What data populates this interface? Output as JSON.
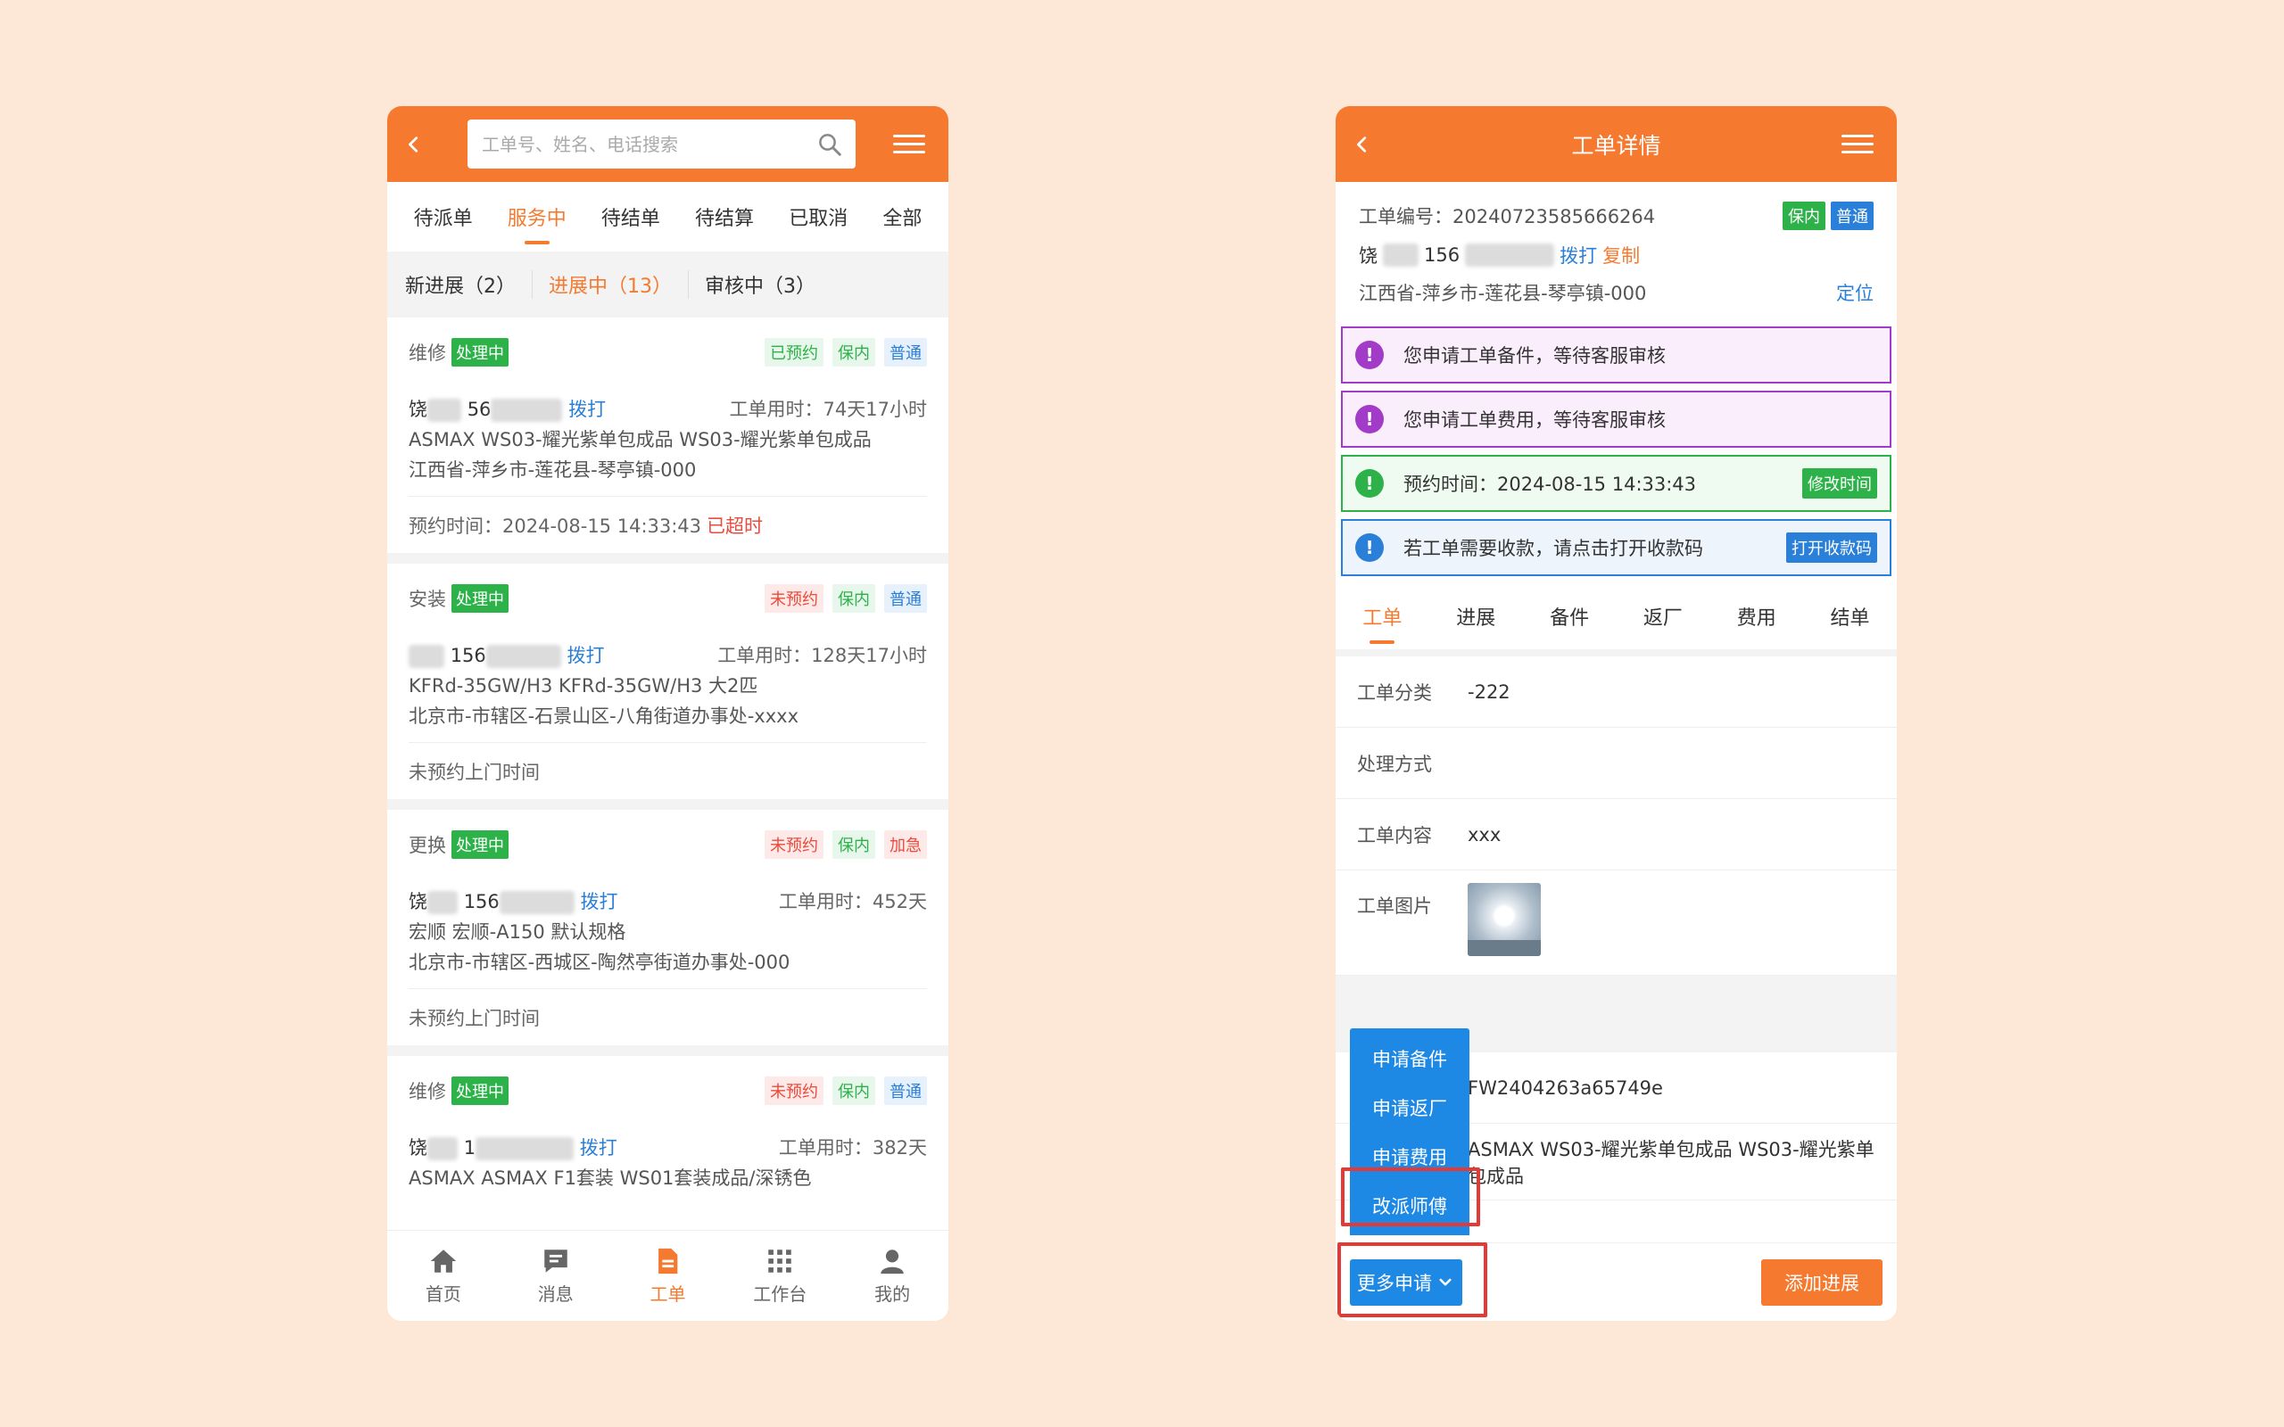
{
  "left": {
    "search": {
      "placeholder": "工单号、姓名、电话搜索"
    },
    "tabs": [
      {
        "label": "待派单"
      },
      {
        "label": "服务中"
      },
      {
        "label": "待结单"
      },
      {
        "label": "待结算"
      },
      {
        "label": "已取消"
      },
      {
        "label": "全部"
      }
    ],
    "active_tab": "服务中",
    "subtabs": [
      {
        "label": "新进展（2）"
      },
      {
        "label": "进展中（13）"
      },
      {
        "label": "审核中（3）"
      }
    ],
    "active_subtab": "进展中（13）",
    "orders": [
      {
        "type": "维修",
        "status": "处理中",
        "tags": [
          {
            "text": "已预约",
            "color": "green"
          },
          {
            "text": "保内",
            "color": "green"
          },
          {
            "text": "普通",
            "color": "blue"
          }
        ],
        "name": "饶",
        "phone": "56",
        "call": "拨打",
        "used_time": "工单用时：74天17小时",
        "product": "ASMAX WS03-耀光紫单包成品 WS03-耀光紫单包成品",
        "address": "江西省-萍乡市-莲花县-琴亭镇-000",
        "appointment": "预约时间：2024-08-15 14:33:43",
        "overtime": "已超时"
      },
      {
        "type": "安装",
        "status": "处理中",
        "tags": [
          {
            "text": "未预约",
            "color": "red"
          },
          {
            "text": "保内",
            "color": "green"
          },
          {
            "text": "普通",
            "color": "blue"
          }
        ],
        "name": "",
        "phone": "156",
        "call": "拨打",
        "used_time": "工单用时：128天17小时",
        "product": "KFRd-35GW/H3 KFRd-35GW/H3 大2匹",
        "address": "北京市-市辖区-石景山区-八角街道办事处-xxxx",
        "appointment": "未预约上门时间",
        "overtime": ""
      },
      {
        "type": "更换",
        "status": "处理中",
        "tags": [
          {
            "text": "未预约",
            "color": "red"
          },
          {
            "text": "保内",
            "color": "green"
          },
          {
            "text": "加急",
            "color": "red"
          }
        ],
        "name": "饶",
        "phone": "156",
        "call": "拨打",
        "used_time": "工单用时：452天",
        "product": "宏顺 宏顺-A150 默认规格",
        "address": "北京市-市辖区-西城区-陶然亭街道办事处-000",
        "appointment": "未预约上门时间",
        "overtime": ""
      },
      {
        "type": "维修",
        "status": "处理中",
        "tags": [
          {
            "text": "未预约",
            "color": "red"
          },
          {
            "text": "保内",
            "color": "green"
          },
          {
            "text": "普通",
            "color": "blue"
          }
        ],
        "name": "饶",
        "phone": "1",
        "call": "拨打",
        "used_time": "工单用时：382天",
        "product": "ASMAX ASMAX F1套装 WS01套装成品/深锈色",
        "address": "",
        "appointment": "",
        "overtime": ""
      }
    ],
    "nav": [
      {
        "label": "首页",
        "icon": "home-icon"
      },
      {
        "label": "消息",
        "icon": "message-icon"
      },
      {
        "label": "工单",
        "icon": "document-icon"
      },
      {
        "label": "工作台",
        "icon": "grid-icon"
      },
      {
        "label": "我的",
        "icon": "user-icon"
      }
    ],
    "active_nav": "工单"
  },
  "right": {
    "title": "工单详情",
    "order_no": "工单编号：20240723585666264",
    "badge_warranty": "保内",
    "badge_level": "普通",
    "customer_name": "饶",
    "customer_phone": "156",
    "call": "拨打",
    "copy": "复制",
    "address": "江西省-萍乡市-莲花县-琴亭镇-000",
    "locate": "定位",
    "notices": [
      {
        "text": "您申请工单备件，等待客服审核",
        "color": "purple",
        "button": ""
      },
      {
        "text": "您申请工单费用，等待客服审核",
        "color": "purple",
        "button": ""
      },
      {
        "text": "预约时间：2024-08-15 14:33:43",
        "color": "green",
        "button": "修改时间"
      },
      {
        "text": "若工单需要收款，请点击打开收款码",
        "color": "blue",
        "button": "打开收款码"
      }
    ],
    "tabs": [
      {
        "label": "工单"
      },
      {
        "label": "进展"
      },
      {
        "label": "备件"
      },
      {
        "label": "返厂"
      },
      {
        "label": "费用"
      },
      {
        "label": "结单"
      }
    ],
    "active_tab": "工单",
    "fields": {
      "category_label": "工单分类",
      "category_value": "-222",
      "method_label": "处理方式",
      "method_value": "",
      "content_label": "工单内容",
      "content_value": "xxx",
      "image_label": "工单图片"
    },
    "partial_code": "FW2404263a65749e",
    "partial_product": "ASMAX WS03-耀光紫单包成品 WS03-耀光紫单包成品",
    "menu_items": [
      {
        "label": "申请备件"
      },
      {
        "label": "申请返厂"
      },
      {
        "label": "申请费用"
      },
      {
        "label": "改派师傅"
      }
    ],
    "more_button": "更多申请",
    "add_button": "添加进展"
  },
  "colors": {
    "background": "#fde7d6",
    "brand_orange": "#f57a30",
    "status_green": "#2db24a",
    "link_blue": "#2a7fd8",
    "menu_blue": "#1e88e5",
    "alert_red": "#e94b3c",
    "highlight_red": "#e53935",
    "notice_purple": "#a23bc7"
  }
}
